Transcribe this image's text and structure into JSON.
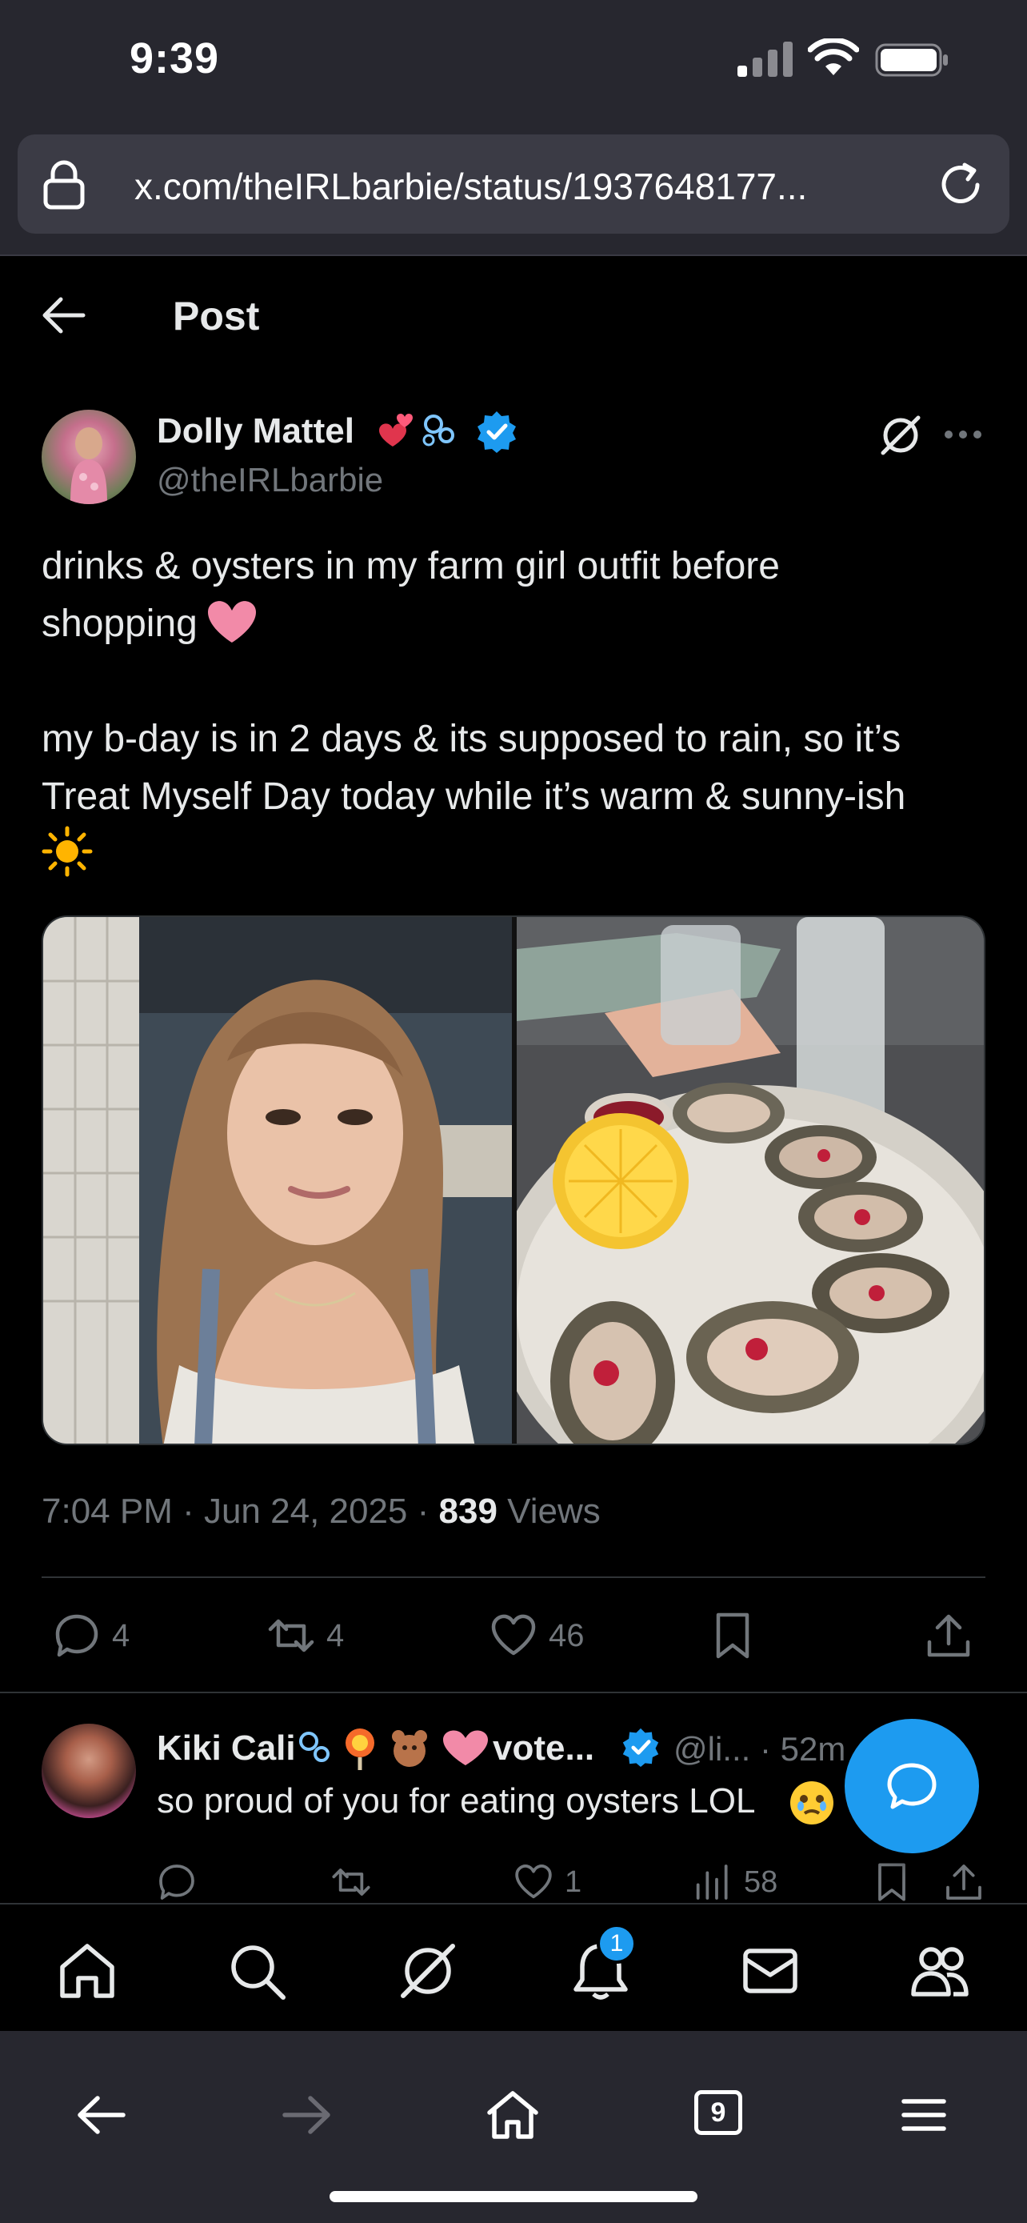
{
  "status_bar": {
    "time": "9:39"
  },
  "browser": {
    "url": "x.com/theIRLbarbie/status/1937648177...",
    "tab_count": "9"
  },
  "header": {
    "title": "Post"
  },
  "post": {
    "author_name": "Dolly Mattel",
    "author_handle": "@theIRLbarbie",
    "text_1": "drinks & oysters in my farm girl outfit before\nshopping",
    "text_2": "my b-day is in 2 days & its supposed to rain, so it’s\nTreat Myself Day today while it’s warm & sunny-ish",
    "time": "7:04 PM · Jun 24, 2025 · ",
    "views_count": "839",
    "views_label": " Views",
    "replies": "4",
    "reposts": "4",
    "likes": "46"
  },
  "reply": {
    "name": "Kiki Cali",
    "name_tail": "vote...",
    "handle": "@li... · 52m",
    "text": "so proud of you for eating oysters LOL",
    "likes": "1",
    "views": "58"
  },
  "notifications_badge": "1",
  "colors": {
    "accent": "#1d9bf0",
    "background": "#000000",
    "secondary_text": "#71767b",
    "chrome": "#27272f"
  }
}
